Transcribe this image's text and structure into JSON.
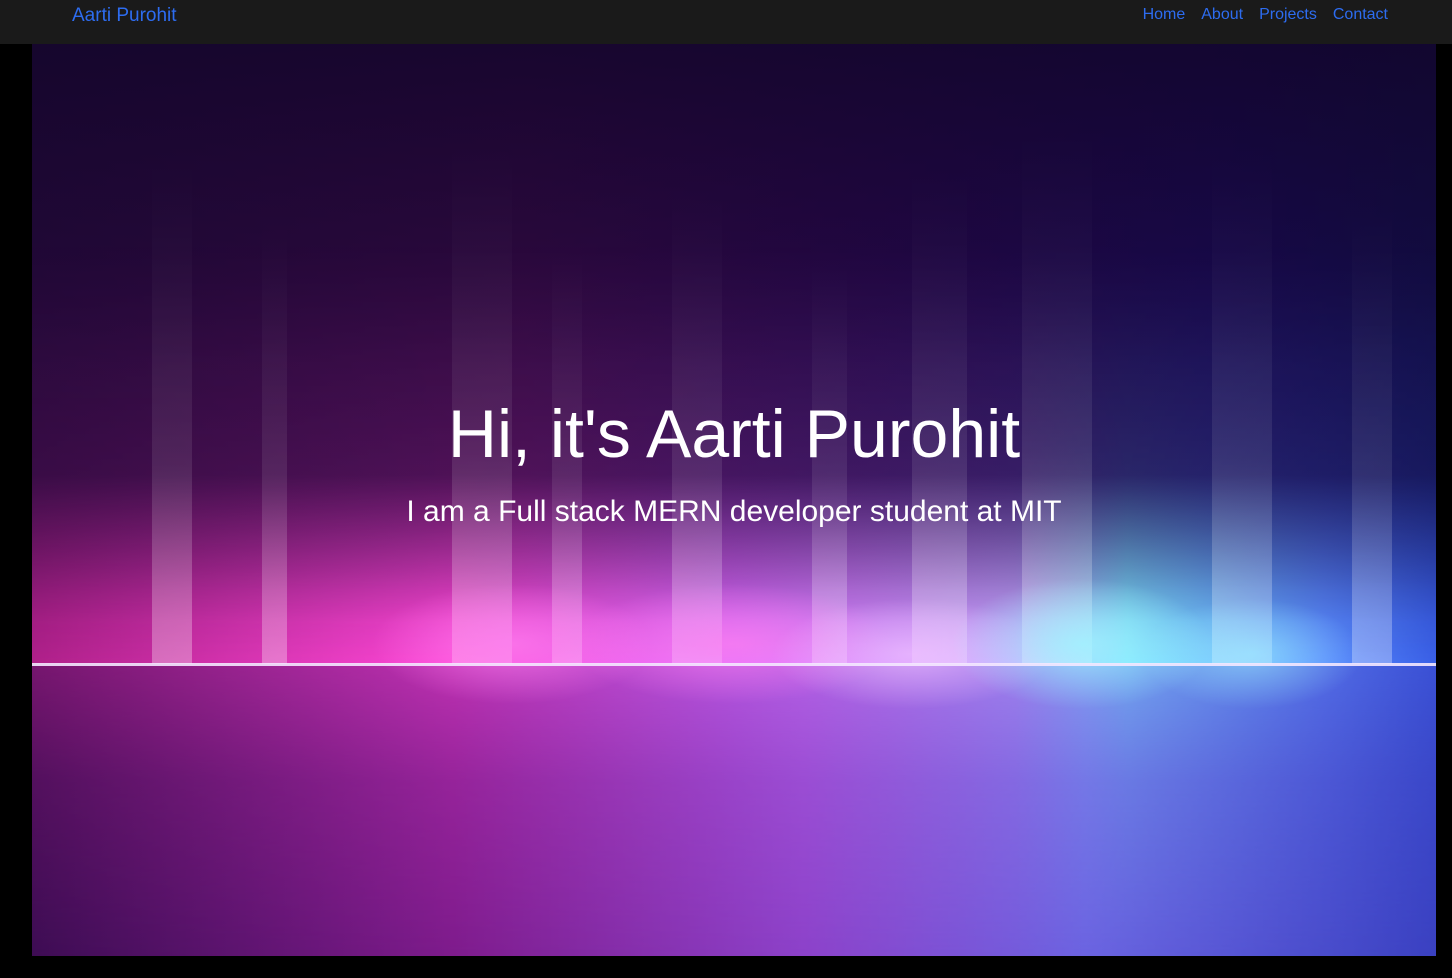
{
  "navbar": {
    "brand": "Aarti Purohit",
    "links": [
      "Home",
      "About",
      "Projects",
      "Contact"
    ]
  },
  "hero": {
    "title": "Hi, it's Aarti Purohit",
    "subtitle": "I am a Full stack MERN developer student at MIT"
  },
  "colors": {
    "navbar_bg": "#1a1a1a",
    "link": "#2d6cf0",
    "page_bg": "#000000",
    "hero_text": "#ffffff"
  }
}
